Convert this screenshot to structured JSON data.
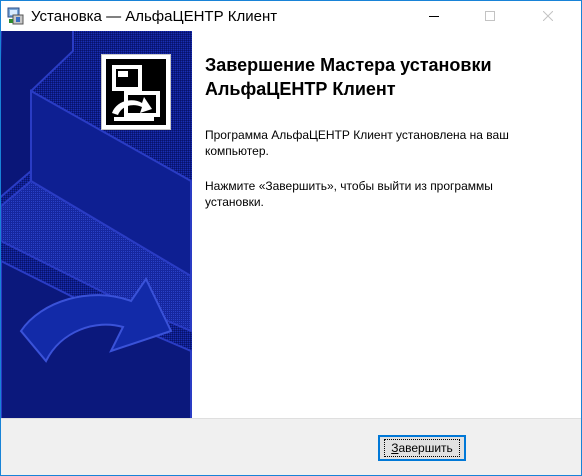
{
  "window": {
    "title": "Установка — АльфаЦЕНТР Клиент",
    "app_icon": "installer-icon",
    "controls": {
      "minimize_icon": "minimize-icon",
      "maximize_icon": "maximize-icon",
      "close_icon": "close-icon"
    }
  },
  "banner": {
    "art": "setup-arrow-banner",
    "background_color": "#0c1b86"
  },
  "wizard_logo": {
    "icon": "computer-install-icon"
  },
  "content": {
    "heading_lines": [
      "Завершение Мастера установки",
      "АльфаЦЕНТР Клиент"
    ],
    "paragraph1_lines": [
      "Программа АльфаЦЕНТР Клиент установлена на ваш",
      "компьютер."
    ],
    "paragraph2_lines": [
      "Нажмите «Завершить», чтобы выйти из программы",
      "установки."
    ]
  },
  "footer": {
    "finish_button": {
      "accesskey": "З",
      "label_rest": "авершить"
    }
  },
  "colors": {
    "accent": "#0078d7",
    "window_border": "#1883d7",
    "footer_bg": "#f0f0f0"
  }
}
